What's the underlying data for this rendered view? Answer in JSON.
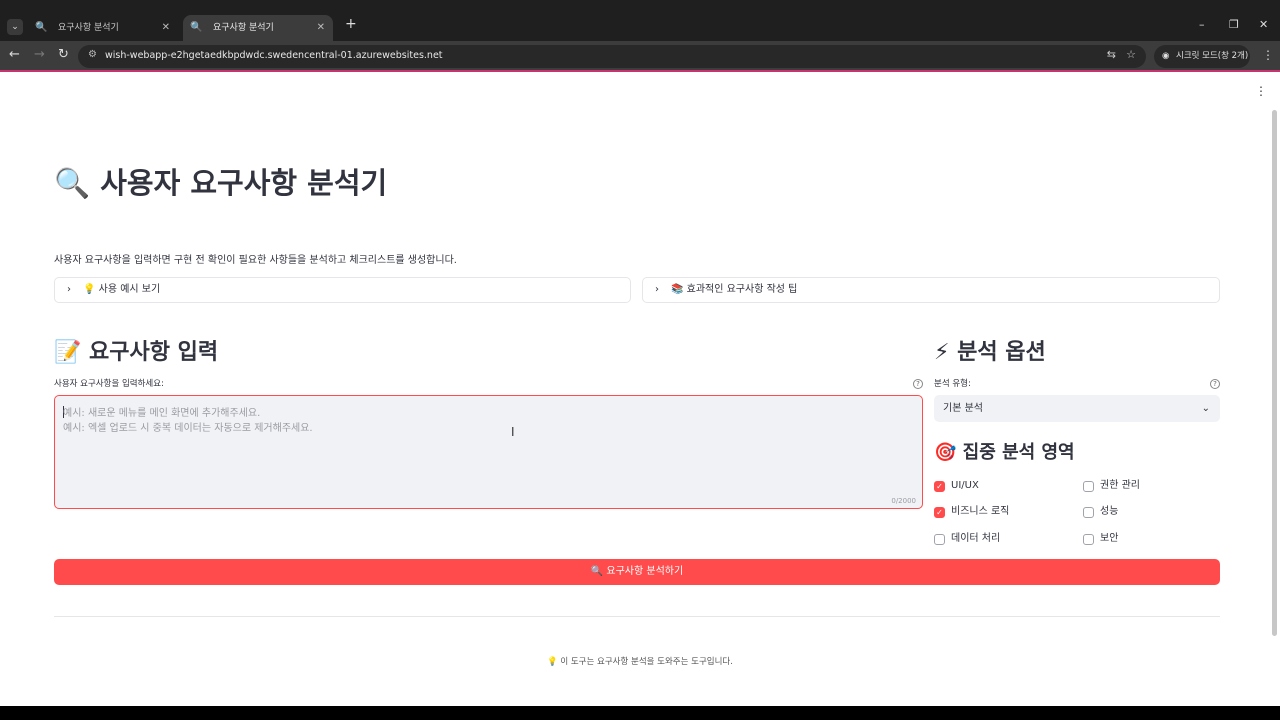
{
  "browser": {
    "tabs": [
      {
        "label": "요구사항 분석기",
        "favicon": "🔍",
        "active": false
      },
      {
        "label": "요구사항 분석기",
        "favicon": "🔍",
        "active": true
      }
    ],
    "url": "wish-webapp-e2hgetaedkbpdwdc.swedencentral-01.azurewebsites.net",
    "incognito_label": "시크릿 모드(창 2개)",
    "theme_accent": "#c8346f"
  },
  "page": {
    "title": "🔍 사용자 요구사항 분석기",
    "intro": "사용자 요구사항을 입력하면 구현 전 확인이 필요한 사항들을 분석하고 체크리스트를 생성합니다.",
    "expanders": [
      {
        "label": "💡 사용 예시 보기"
      },
      {
        "label": "📚 효과적인 요구사항 작성 팁"
      }
    ],
    "requirements": {
      "heading": "📝 요구사항 입력",
      "label": "사용자 요구사항을 입력하세요:",
      "placeholder_line1": "예시: 새로운 메뉴를 메인 화면에 추가해주세요.",
      "placeholder_line2": "예시: 엑셀 업로드 시 중복 데이터는 자동으로 제거해주세요.",
      "counter": "0/2000"
    },
    "options": {
      "heading": "⚡ 분석 옵션",
      "type_label": "분석 유형:",
      "type_value": "기본 분석",
      "focus_heading": "🎯 집중 분석 영역",
      "focus_areas": [
        {
          "label": "UI/UX",
          "checked": true
        },
        {
          "label": "권한 관리",
          "checked": false
        },
        {
          "label": "비즈니스 로직",
          "checked": true
        },
        {
          "label": "성능",
          "checked": false
        },
        {
          "label": "데이터 처리",
          "checked": false
        },
        {
          "label": "보안",
          "checked": false
        }
      ]
    },
    "analyze_button": "🔍 요구사항 분석하기",
    "footer": "💡 이 도구는 요구사항 분석을 도와주는 도구입니다."
  },
  "colors": {
    "primary": "#ff4b4b",
    "text": "#31333f",
    "input_bg": "#f0f2f6"
  }
}
